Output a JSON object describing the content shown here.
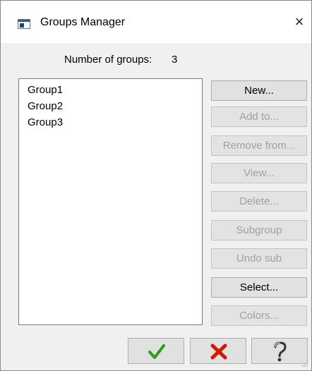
{
  "window": {
    "title": "Groups Manager",
    "close_glyph": "×"
  },
  "summary": {
    "count_label": "Number of groups:",
    "count_value": "3"
  },
  "groups_list": {
    "items": [
      "Group1",
      "Group2",
      "Group3"
    ]
  },
  "buttons": {
    "new": {
      "label": "New...",
      "enabled": true
    },
    "add_to": {
      "label": "Add to...",
      "enabled": false
    },
    "remove_from": {
      "label": "Remove from...",
      "enabled": false
    },
    "view": {
      "label": "View...",
      "enabled": false
    },
    "delete": {
      "label": "Delete...",
      "enabled": false
    },
    "subgroup": {
      "label": "Subgroup",
      "enabled": false
    },
    "undo_sub": {
      "label": "Undo sub",
      "enabled": false
    },
    "select": {
      "label": "Select...",
      "enabled": true
    },
    "colors": {
      "label": "Colors...",
      "enabled": false
    }
  },
  "bottom_buttons": {
    "ok": {
      "icon": "check-icon",
      "color": "#2e9e1a"
    },
    "cancel": {
      "icon": "x-icon",
      "color": "#d21a0a"
    },
    "help": {
      "icon": "question-icon",
      "color": "#333333"
    }
  }
}
